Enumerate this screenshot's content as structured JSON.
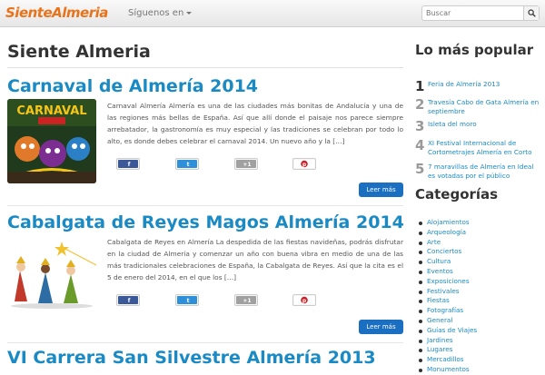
{
  "header": {
    "logo_a": "Siente",
    "logo_b": "Almeria",
    "menu_label": "Síguenos en",
    "search_placeholder": "Buscar"
  },
  "main": {
    "title": "Siente Almeria",
    "read_more": "Leer más",
    "posts": [
      {
        "title": "Carnaval de Almería 2014",
        "excerpt": "Carnaval Almería Almería es una de las ciudades más bonitas de Andalucía y una de las regiones más bellas de España. Así que allí donde el paisaje nos parece siempre arrebatador, la gastronomía es muy especial y las tradiciones se celebran por todo lo alto, es donde debes celebrar el carnaval 2014. Un nuevo año y la […]",
        "thumb_text": "CARNAVAL"
      },
      {
        "title": "Cabalgata de Reyes Magos Almería 2014",
        "excerpt": "Cabalgata de Reyes en Almería La despedida de las fiestas navideñas, podrás disfrutar en la ciudad de Almería y comenzar un año con buena vibra en medio de una de las más tradicionales celebraciones de España, la Cabalgata de Reyes. Así que la cita es el 5 de enero del 2014, en el que los […]"
      },
      {
        "title": "VI Carrera San Silvestre Almería 2013"
      }
    ],
    "share": {
      "facebook_icon": "f",
      "twitter_icon": "t",
      "gplus_label": "+1",
      "pinterest_icon": "p"
    }
  },
  "sidebar": {
    "popular_title": "Lo más popular",
    "popular": [
      {
        "num": "1",
        "text": "Feria de Almería 2013"
      },
      {
        "num": "2",
        "text": "Travesía Cabo de Gata Almería en septiembre"
      },
      {
        "num": "3",
        "text": "Isleta del moro"
      },
      {
        "num": "4",
        "text": "XI Festival Internacional de Cortometrajes Almería en Corto"
      },
      {
        "num": "5",
        "text": "7 maravillas de Almería en Ideal es votadas por el público"
      }
    ],
    "categories_title": "Categorías",
    "categories": [
      "Alojamientos",
      "Arqueología",
      "Arte",
      "Conciertos",
      "Cultura",
      "Eventos",
      "Exposiciones",
      "Festivales",
      "Fiestas",
      "Fotografías",
      "General",
      "Guías de Viajes",
      "Jardines",
      "Lugares",
      "Mercadillos",
      "Monumentos"
    ]
  },
  "colors": {
    "accent": "#1a8ac4",
    "brand": "#e8731a",
    "button": "#1a6fc0",
    "facebook": "#3b5998",
    "twitter": "#2f8fd8",
    "gplus": "#a0a0a0",
    "pinterest": "#cb2027"
  }
}
